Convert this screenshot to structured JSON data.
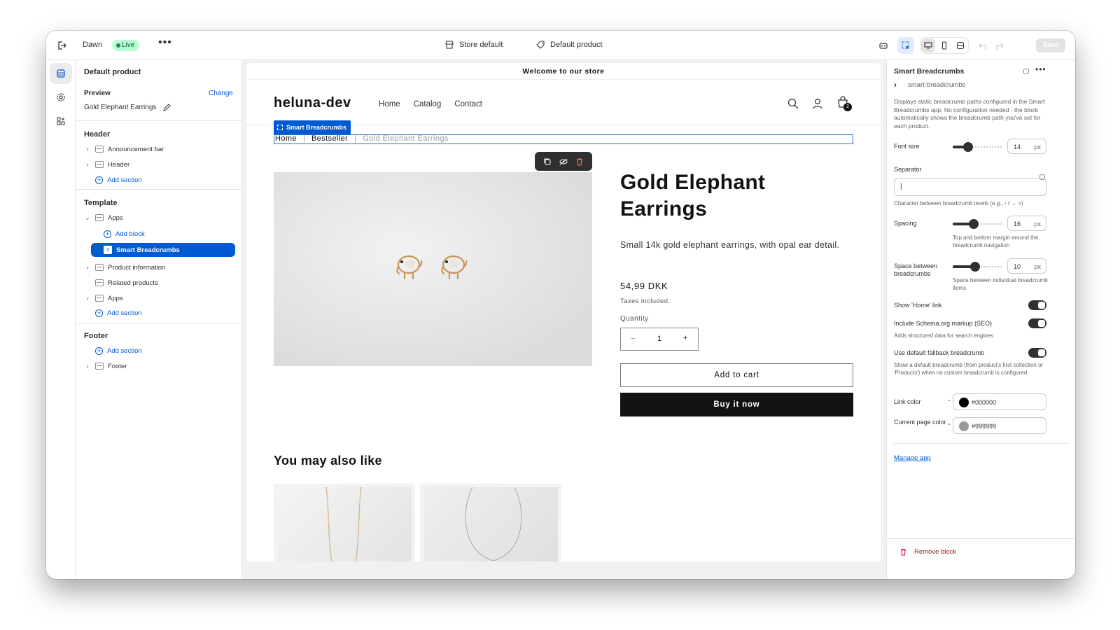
{
  "topbar": {
    "theme_name": "Dawn",
    "live_label": "Live",
    "more_label": "•••",
    "store_label": "Store default",
    "product_label": "Default product",
    "save_label": "Save"
  },
  "left_panel": {
    "title": "Default product",
    "preview_label": "Preview",
    "change_label": "Change",
    "preview_value": "Gold Elephant Earrings",
    "header_group": "Header",
    "header_items": [
      "Announcement bar",
      "Header"
    ],
    "add_section": "Add section",
    "template_group": "Template",
    "apps_label": "Apps",
    "add_block": "Add block",
    "selected_block": "Smart Breadcrumbs",
    "template_items": [
      "Product information",
      "Related products",
      "Apps"
    ],
    "footer_group": "Footer",
    "footer_item": "Footer"
  },
  "store": {
    "announcement": "Welcome to our store",
    "logo": "heluna-dev",
    "nav": [
      "Home",
      "Catalog",
      "Contact"
    ],
    "cart_count": "2",
    "block_tag": "Smart Breadcrumbs",
    "breadcrumbs": [
      "Home",
      "Bestseller",
      "Gold Elephant Earrings"
    ],
    "breadcrumb_sep": "|",
    "product_title": "Gold Elephant Earrings",
    "description": "Small 14k gold elephant earrings, with opal ear detail.",
    "price": "54,99 DKK",
    "taxes": "Taxes included.",
    "quantity_label": "Quantity",
    "quantity_value": "1",
    "minus": "−",
    "plus": "+",
    "add_to_cart": "Add to cart",
    "buy_now": "Buy it now",
    "related_title": "You may also like"
  },
  "right_panel": {
    "title": "Smart Breadcrumbs",
    "more_label": "•••",
    "handle": "smart-breadcrumbs",
    "description": "Displays static breadcrumb paths configured in the Smart Breadcrumbs app. No configuration needed - the block automatically shows the breadcrumb path you've set for each product.",
    "font_size_label": "Font size",
    "font_size_value": "14",
    "unit": "px",
    "font_size_fraction": 0.3,
    "separator_label": "Separator",
    "separator_value": "|",
    "separator_help": "Character between breadcrumb levels (e.g., › / → »)",
    "spacing_label": "Spacing",
    "spacing_value": "16",
    "spacing_fraction": 0.42,
    "spacing_help": "Top and bottom margin around the breadcrumb navigation",
    "space_between_label": "Space between breadcrumbs",
    "space_between_value": "10",
    "space_between_fraction": 0.44,
    "space_between_help": "Space between individual breadcrumb items",
    "show_home_label": "Show 'Home' link",
    "schema_label": "Include Schema.org markup (SEO)",
    "schema_help": "Adds structured data for search engines",
    "fallback_label": "Use default fallback breadcrumb",
    "fallback_help": "Show a default breadcrumb (from product's first collection or 'Products') when no custom breadcrumb is configured",
    "link_color_label": "Link color",
    "link_color_value": "#000000",
    "current_color_label": "Current page color",
    "current_color_value": "#999999",
    "manage_app": "Manage app",
    "remove_block": "Remove block"
  },
  "colors": {
    "accent": "#005bd3",
    "live_bg": "#b4fed2",
    "remove": "#c70a24"
  }
}
